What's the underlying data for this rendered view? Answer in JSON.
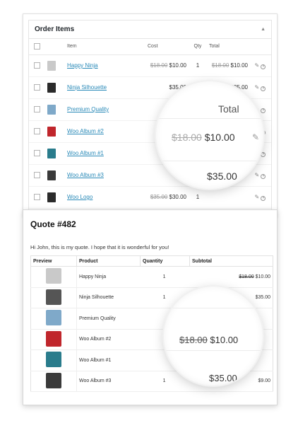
{
  "admin": {
    "title": "Order Items",
    "headers": {
      "item": "Item",
      "cost": "Cost",
      "qty": "Qty",
      "total": "Total"
    },
    "rows": [
      {
        "name": "Happy Ninja",
        "cost_old": "$18.00",
        "cost": "$10.00",
        "qty": "1",
        "total_old": "$18.00",
        "total": "$10.00",
        "thumb": "tshirt-gray"
      },
      {
        "name": "Ninja Silhouette",
        "cost_old": "",
        "cost": "$35.00",
        "qty": "1",
        "total_old": "",
        "total": "$35.00",
        "thumb": "hoodie-black"
      },
      {
        "name": "Premium Quality",
        "cost_old": "",
        "cost": "",
        "qty": "",
        "total_old": "",
        "total": "",
        "thumb": "tshirt-blue"
      },
      {
        "name": "Woo Album #2",
        "cost_old": "",
        "cost": "",
        "qty": "",
        "total_old": "",
        "total": "",
        "thumb": "album-red"
      },
      {
        "name": "Woo Album #1",
        "cost_old": "",
        "cost": "",
        "qty": "",
        "total_old": "",
        "total": "",
        "thumb": "album-teal"
      },
      {
        "name": "Woo Album #3",
        "cost_old": "",
        "cost": "",
        "qty": "",
        "total_old": "",
        "total": "",
        "thumb": "album-dark"
      },
      {
        "name": "Woo Logo",
        "cost_old": "$35.00",
        "cost": "$30.00",
        "qty": "1",
        "total_old": "",
        "total": "",
        "thumb": "hoodie-black"
      }
    ],
    "magnifier": {
      "header": "Total",
      "price_old": "$18.00",
      "price": "$10.00",
      "price2": "$35.00"
    }
  },
  "email": {
    "title": "Quote #482",
    "message": "Hi John, this is my quote. I hope that it is wonderful for you!",
    "headers": {
      "preview": "Preview",
      "product": "Product",
      "quantity": "Quantity",
      "subtotal": "Subtotal"
    },
    "rows": [
      {
        "product": "Happy Ninja",
        "qty": "1",
        "sub_old": "$18.00",
        "sub": "$10.00",
        "thumb": "tshirt-gray"
      },
      {
        "product": "Ninja Silhouette",
        "qty": "1",
        "sub_old": "",
        "sub": "$35.00",
        "thumb": "hoodie-gray"
      },
      {
        "product": "Premium Quality",
        "qty": "",
        "sub_old": "",
        "sub": "",
        "thumb": "tshirt-blue"
      },
      {
        "product": "Woo Album #2",
        "qty": "",
        "sub_old": "",
        "sub": "",
        "thumb": "album-red"
      },
      {
        "product": "Woo Album #1",
        "qty": "",
        "sub_old": "",
        "sub": "",
        "thumb": "album-teal"
      },
      {
        "product": "Woo Album #3",
        "qty": "1",
        "sub_old": "",
        "sub": "$9.00",
        "thumb": "album-dark"
      }
    ],
    "magnifier": {
      "price_old": "$18.00",
      "price": "$10.00",
      "price2": "$35.00"
    }
  },
  "colors": {
    "link": "#2a8ab8",
    "strike": "#999999"
  }
}
